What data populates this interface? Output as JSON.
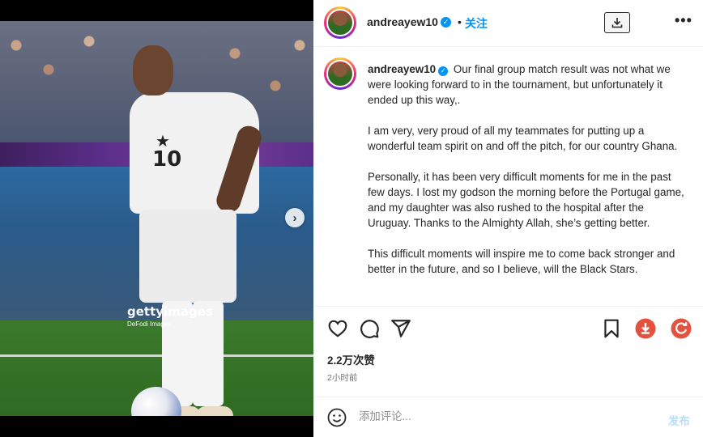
{
  "colors": {
    "accent": "#0095f6",
    "text": "#262626",
    "muted": "#737373",
    "post_disabled": "#b2dffc",
    "red_button": "#e4523f"
  },
  "media": {
    "watermark_brand": "gettyimages",
    "watermark_credit": "DeFodi Images",
    "jersey_number": "10",
    "next_icon": "chevron-right-icon"
  },
  "header": {
    "username": "andreayew10",
    "separator": "•",
    "follow_label": "关注",
    "download_icon": "download-icon",
    "more_label": "•••"
  },
  "caption": {
    "username": "andreayew10",
    "paragraphs": [
      "Our final group match result was not what we were looking forward to in the tournament, but unfortunately it ended up this way,.",
      "I am very, very proud of all my teammates for putting up a wonderful team spirit on and off the pitch, for our country Ghana.",
      "Personally, it has been very difficult moments for me in the past few days. I lost my godson the morning before the Portugal game, and my daughter was also rushed to the hospital after the Uruguay. Thanks to the Almighty Allah, she’s getting better.",
      "This difficult moments will inspire me to come back stronger and better in the future, and so I believe, will the Black Stars."
    ]
  },
  "actions": {
    "likes": "2.2万次赞",
    "time": "2小时前"
  },
  "comment": {
    "placeholder": "添加评论...",
    "post_label": "发布"
  }
}
